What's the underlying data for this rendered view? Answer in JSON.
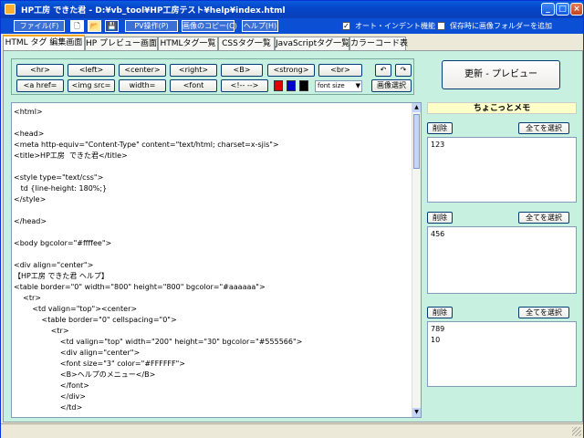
{
  "window": {
    "title": "HP工房 できた君  - D:¥vb_tool¥HP工房テスト¥help¥index.html"
  },
  "titlebar_buttons": [
    "_",
    "□",
    "×"
  ],
  "menubar": {
    "file": "ファイル(F)",
    "pv_op": "PV操作(P)",
    "image_copy": "画像のコピー(C)",
    "help": "ヘルプ(H)",
    "auto_indent": {
      "label": "オート・インデント機能",
      "checked": true
    },
    "save_image_folder": {
      "label": "保存時に画像フォルダーを追加",
      "checked": false
    }
  },
  "tabs": [
    {
      "label": "HTML タグ 編集画面",
      "active": true
    },
    {
      "label": "HP プレビュー画面",
      "active": false
    },
    {
      "label": "HTMLタグ一覧",
      "active": false
    },
    {
      "label": "CSSタグ一覧",
      "active": false
    },
    {
      "label": "JavaScriptタグ一覧",
      "active": false
    },
    {
      "label": "カラーコード表",
      "active": false
    }
  ],
  "tag_buttons": {
    "hr": "<hr>",
    "left": "<left>",
    "center": "<center>",
    "right": "<right>",
    "b": "<B>",
    "strong": "<strong>",
    "br": "<br>",
    "a_href": "<a href=",
    "img_src": "<img src=",
    "width": "width=",
    "font": "<font",
    "comment": "<!-- -->"
  },
  "undo_icon": "↶",
  "redo_icon": "↷",
  "colors": {
    "red": "#e00000",
    "blue": "#0000d0",
    "black": "#000000"
  },
  "font_size_select": {
    "value": "font size"
  },
  "image_select_button": "画像選択",
  "refresh_button": "更新 - プレビュー",
  "editor_lines": [
    "<html>",
    "",
    "<head>",
    "<meta http-equiv=\"Content-Type\" content=\"text/html; charset=x-sjis\">",
    "<title>HP工房  できた君</title>",
    "",
    "<style type=\"text/css\">",
    "   td {line-height: 180%;}",
    "</style>",
    "",
    "</head>",
    "",
    "<body bgcolor=\"#ffffee\">",
    "",
    "<div align=\"center\">",
    "【HP工房 できた君 ヘルプ】",
    "<table border=\"0\" width=\"800\" height=\"800\" bgcolor=\"#aaaaaa\">",
    "    <tr>",
    "        <td valign=\"top\"><center>",
    "            <table border=\"0\" cellspacing=\"0\">",
    "                <tr>",
    "                    <td valign=\"top\" width=\"200\" height=\"30\" bgcolor=\"#555566\">",
    "                    <div align=\"center\">",
    "                    <font size=\"3\" color=\"#FFFFFF\">",
    "                    <B>ヘルプのメニュー</B>",
    "                    </font>",
    "                    </div>",
    "                    </td>"
  ],
  "memo": {
    "title": "ちょこっとメモ",
    "delete_label": "削除",
    "select_all_label": "全てを選択",
    "memo1": "123",
    "memo2": "456",
    "memo3": "789\n10"
  }
}
